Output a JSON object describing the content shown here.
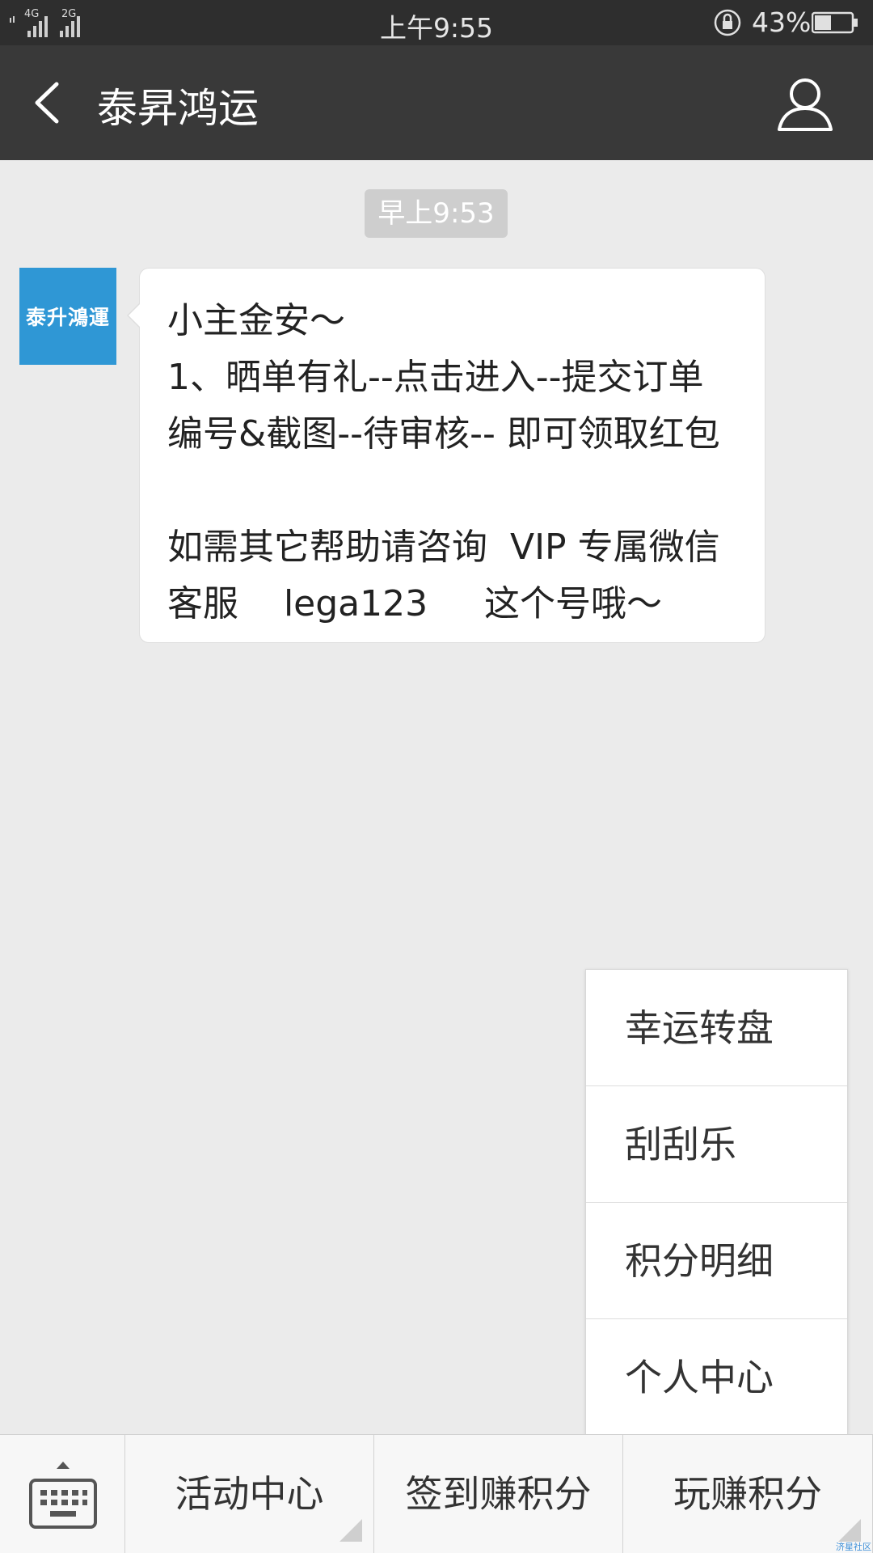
{
  "status_bar": {
    "network_primary": "4G",
    "network_secondary": "2G",
    "time": "上午9:55",
    "battery_percent": "43%"
  },
  "title_bar": {
    "title": "泰昇鸿运"
  },
  "chat": {
    "timestamp": "早上9:53",
    "sender_avatar_text": "泰升鴻運",
    "message_lines": [
      "小主金安～",
      "1、晒单有礼--点击进入--提交订单",
      "编号&截图--待审核-- 即可领取红包",
      "",
      "如需其它帮助请咨询  VIP 专属微信",
      "客服    lega123     这个号哦～"
    ]
  },
  "popup_menu": {
    "items": [
      "幸运转盘",
      "刮刮乐",
      "积分明细",
      "个人中心"
    ]
  },
  "bottom_menu": {
    "items": [
      "活动中心",
      "签到赚积分",
      "玩赚积分"
    ]
  },
  "watermark": "济星社区",
  "colors": {
    "status_bar_bg": "#2e2e2e",
    "title_bar_bg": "#393939",
    "chat_bg": "#ebebeb",
    "avatar_bg": "#2f97d5",
    "bubble_bg": "#ffffff"
  }
}
